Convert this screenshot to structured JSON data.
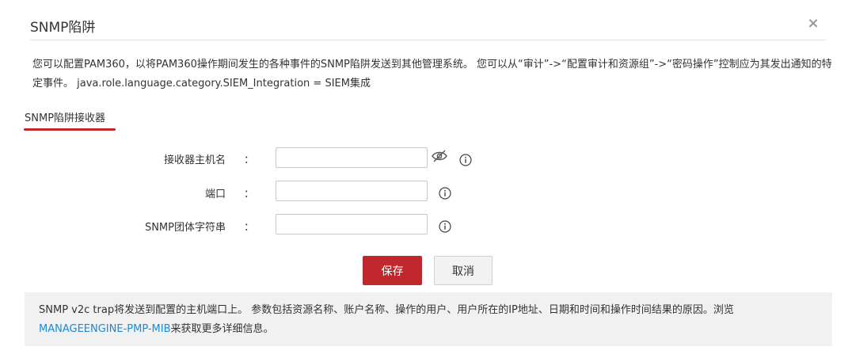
{
  "dialog": {
    "title": "SNMP陷阱",
    "close_symbol": "×"
  },
  "description": "您可以配置PAM360，以将PAM360操作期间发生的各种事件的SNMP陷阱发送到其他管理系统。 您可以从“审计”->“配置审计和资源组”->“密码操作”控制应为其发出通知的特定事件。 java.role.language.category.SIEM_Integration = SIEM集成",
  "tab": {
    "label": "SNMP陷阱接收器"
  },
  "form": {
    "colon": "：",
    "fields": [
      {
        "label": "接收器主机名",
        "value": "",
        "has_visibility_toggle": true,
        "icon": "info-icon"
      },
      {
        "label": "端口",
        "value": "",
        "has_visibility_toggle": false,
        "icon": "info-icon"
      },
      {
        "label": "SNMP团体字符串",
        "value": "",
        "has_visibility_toggle": false,
        "icon": "info-icon"
      }
    ]
  },
  "buttons": {
    "save": "保存",
    "cancel": "取消"
  },
  "note": {
    "text_before": "SNMP v2c trap将发送到配置的主机端口上。 参数包括资源名称、账户名称、操作的用户、用户所在的IP地址、日期和时间和操作时间结果的原因。浏览",
    "link_text": "MANAGEENGINE-PMP-MIB",
    "text_after": "来获取更多详细信息。"
  },
  "colors": {
    "accent": "#c0282d",
    "link": "#1a8bd8",
    "note_background": "#f1f1f1"
  }
}
